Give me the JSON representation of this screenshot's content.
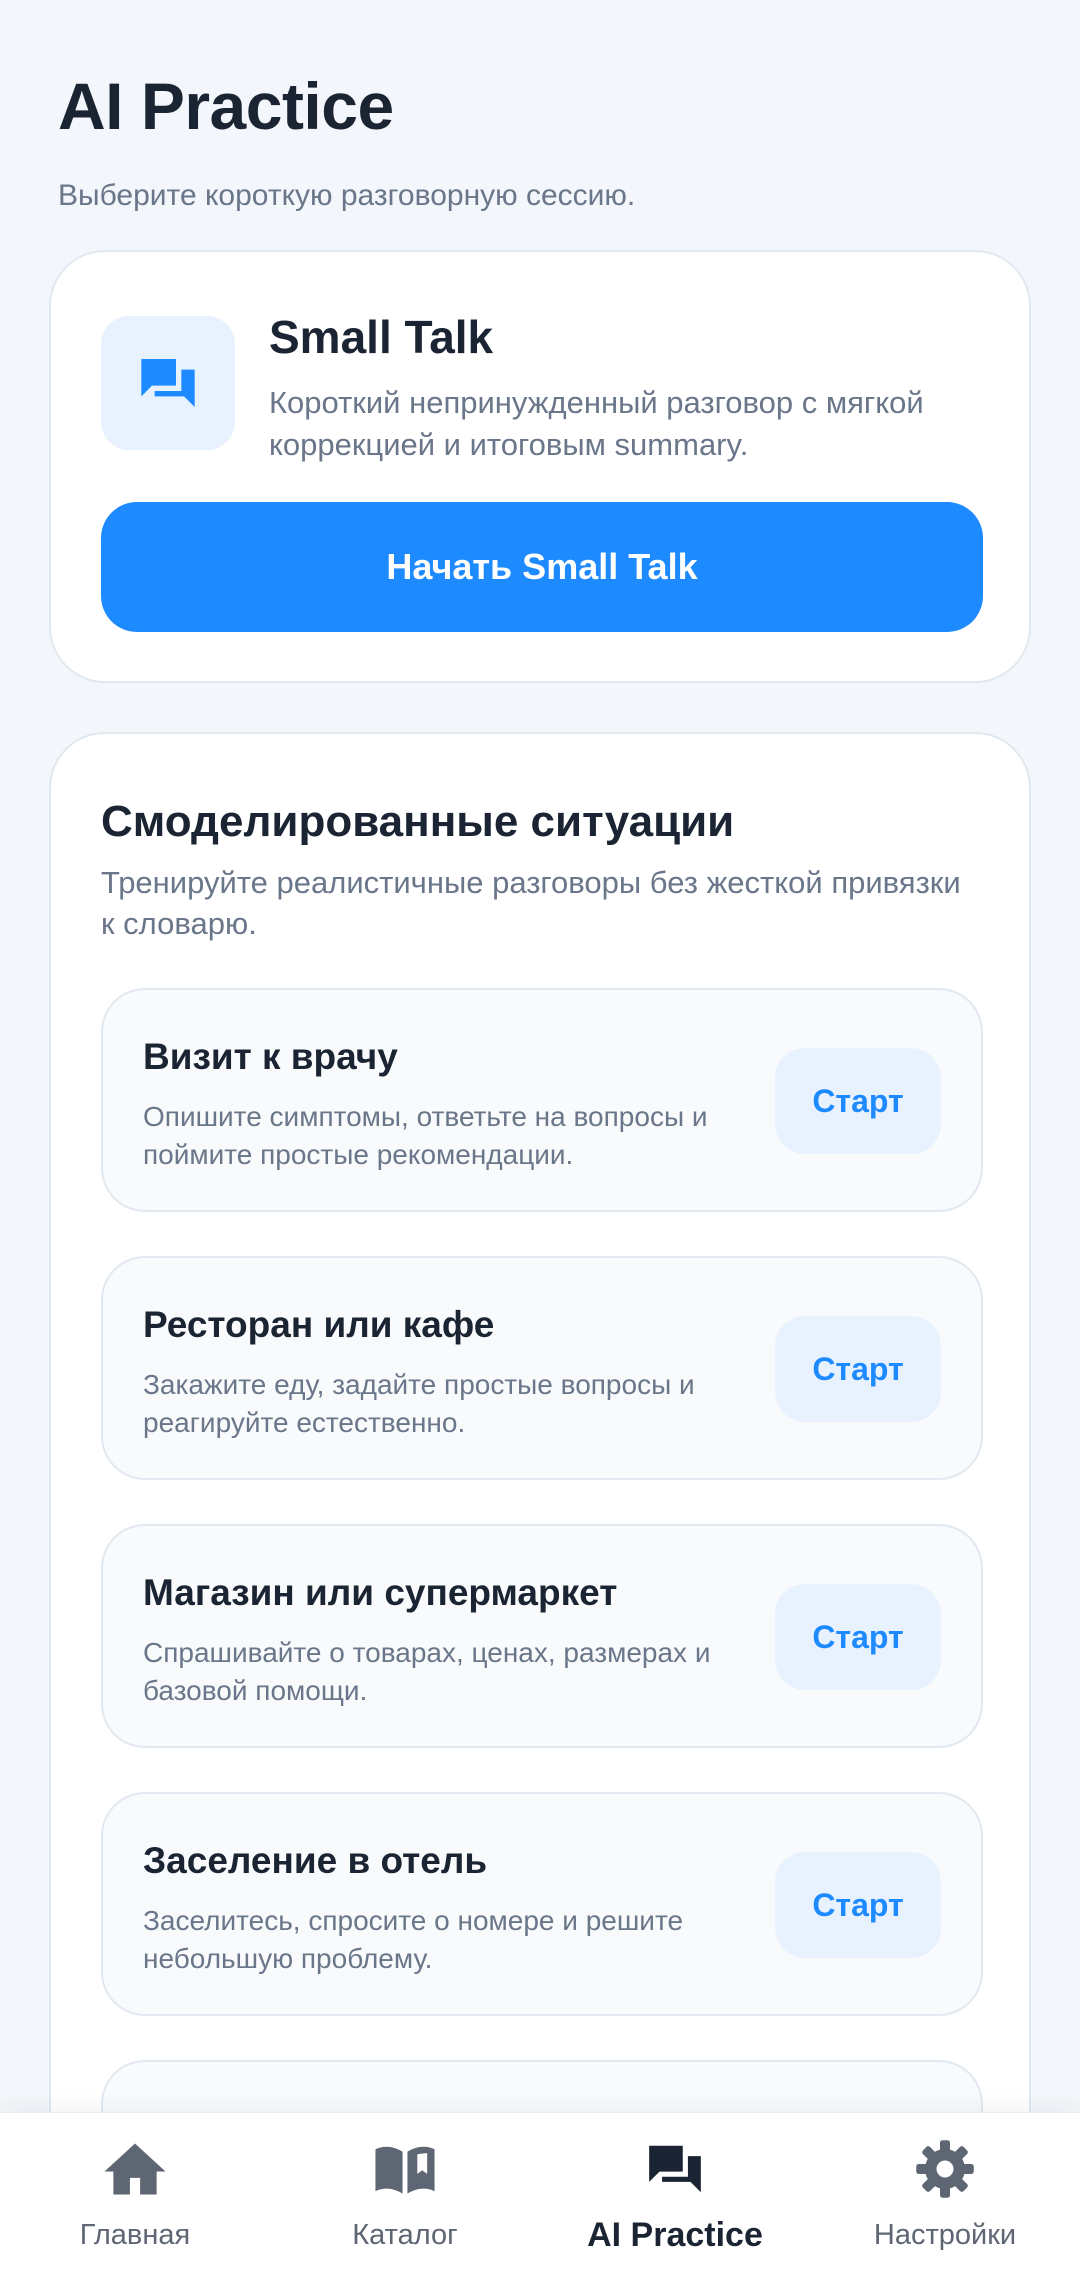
{
  "header": {
    "title": "AI Practice",
    "subtitle": "Выберите короткую разговорную сессию."
  },
  "small_talk": {
    "icon": "chat-bubbles-icon",
    "title": "Small Talk",
    "description": "Короткий непринужденный разговор с мягкой коррекцией и итоговым summary.",
    "button_label": "Начать Small Talk"
  },
  "situations": {
    "title": "Смоделированные ситуации",
    "description": "Тренируйте реалистичные разговоры без жесткой привязки к словарю.",
    "items": [
      {
        "title": "Визит к врачу",
        "description": "Опишите симптомы, ответьте на вопросы и поймите простые рекомендации.",
        "button_label": "Старт"
      },
      {
        "title": "Ресторан или кафе",
        "description": "Закажите еду, задайте простые вопросы и реагируйте естественно.",
        "button_label": "Старт"
      },
      {
        "title": "Магазин или супермаркет",
        "description": "Спрашивайте о товарах, ценах, размерах и базовой помощи.",
        "button_label": "Старт"
      },
      {
        "title": "Заселение в отель",
        "description": "Заселитесь, спросите о номере и решите небольшую проблему.",
        "button_label": "Старт"
      }
    ]
  },
  "nav": {
    "items": [
      {
        "label": "Главная",
        "icon": "home-icon",
        "active": false
      },
      {
        "label": "Каталог",
        "icon": "book-icon",
        "active": false
      },
      {
        "label": "AI Practice",
        "icon": "chat-bubbles-icon",
        "active": true
      },
      {
        "label": "Настройки",
        "icon": "gear-icon",
        "active": false
      }
    ]
  },
  "colors": {
    "accent": "#1e8aff",
    "background": "#f3f6fa",
    "text_primary": "#1b2433",
    "text_secondary": "#6a7689"
  }
}
